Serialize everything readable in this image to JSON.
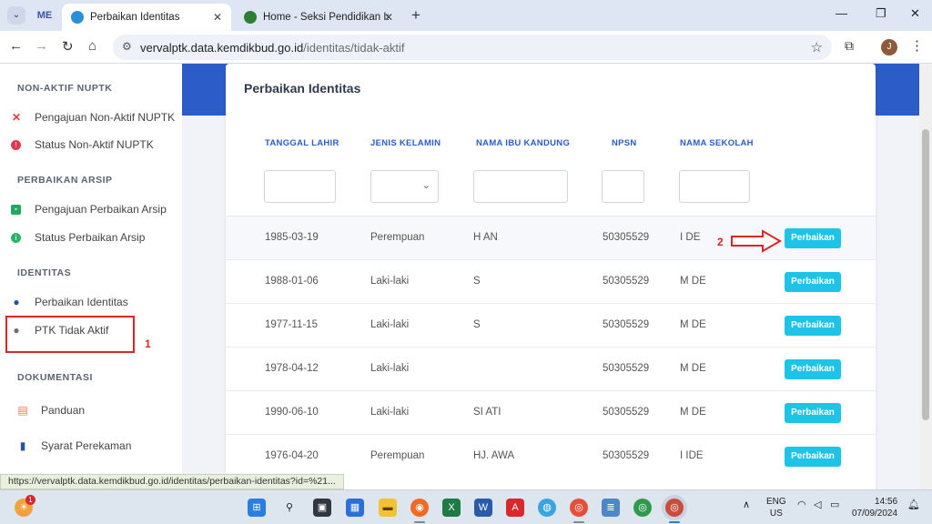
{
  "browser": {
    "pinned_tab": "ME",
    "tabs": [
      {
        "label": "Perbaikan Identitas",
        "active": true
      },
      {
        "label": "Home - Seksi Pendidikan Islam",
        "active": false
      }
    ],
    "url_domain": "vervalptk.data.kemdikbud.go.id",
    "url_path": "/identitas/tidak-aktif",
    "avatar_letter": "J",
    "status_url": "https://vervalptk.data.kemdikbud.go.id/identitas/perbaikan-identitas?id=%21..."
  },
  "sidebar": {
    "sections": [
      {
        "title": "NON-AKTIF NUPTK",
        "items": [
          {
            "label": "Pengajuan Non-Aktif NUPTK",
            "icon": "x-icon"
          },
          {
            "label": "Status Non-Aktif NUPTK",
            "icon": "alert-circle-icon"
          }
        ]
      },
      {
        "title": "PERBAIKAN ARSIP",
        "items": [
          {
            "label": "Pengajuan Perbaikan Arsip",
            "icon": "id-card-icon"
          },
          {
            "label": "Status Perbaikan Arsip",
            "icon": "info-circle-icon"
          }
        ]
      },
      {
        "title": "IDENTITAS",
        "items": [
          {
            "label": "Perbaikan Identitas",
            "icon": "user-icon"
          },
          {
            "label": "PTK Tidak Aktif",
            "icon": "user-icon"
          }
        ]
      },
      {
        "title": "DOKUMENTASI",
        "items": [
          {
            "label": "Panduan",
            "icon": "document-icon"
          },
          {
            "label": "Syarat Perekaman",
            "icon": "file-icon"
          }
        ]
      }
    ]
  },
  "annotations": {
    "step1": "1",
    "step2": "2"
  },
  "card": {
    "title": "Perbaikan Identitas",
    "columns": [
      "TANGGAL LAHIR",
      "JENIS KELAMIN",
      "NAMA IBU KANDUNG",
      "NPSN",
      "NAMA SEKOLAH"
    ],
    "button_label": "Perbaikan",
    "rows": [
      {
        "tanggal": "1985-03-19",
        "jk": "Perempuan",
        "ibu": "H          AN",
        "npsn": "50305529",
        "sekolah": "I          DE"
      },
      {
        "tanggal": "1988-01-06",
        "jk": "Laki-laki",
        "ibu": "S",
        "npsn": "50305529",
        "sekolah": "M          DE"
      },
      {
        "tanggal": "1977-11-15",
        "jk": "Laki-laki",
        "ibu": "S",
        "npsn": "50305529",
        "sekolah": "M          DE"
      },
      {
        "tanggal": "1978-04-12",
        "jk": "Laki-laki",
        "ibu": "",
        "npsn": "50305529",
        "sekolah": "M          DE"
      },
      {
        "tanggal": "1990-06-10",
        "jk": "Laki-laki",
        "ibu": "SI             ATI",
        "npsn": "50305529",
        "sekolah": "M          DE"
      },
      {
        "tanggal": "1976-04-20",
        "jk": "Perempuan",
        "ibu": "HJ.             AWA",
        "npsn": "50305529",
        "sekolah": "I          IDE"
      }
    ]
  },
  "taskbar": {
    "lang_top": "ENG",
    "lang_bottom": "US",
    "time": "14:56",
    "date": "07/09/2024",
    "notification_count": "1"
  }
}
